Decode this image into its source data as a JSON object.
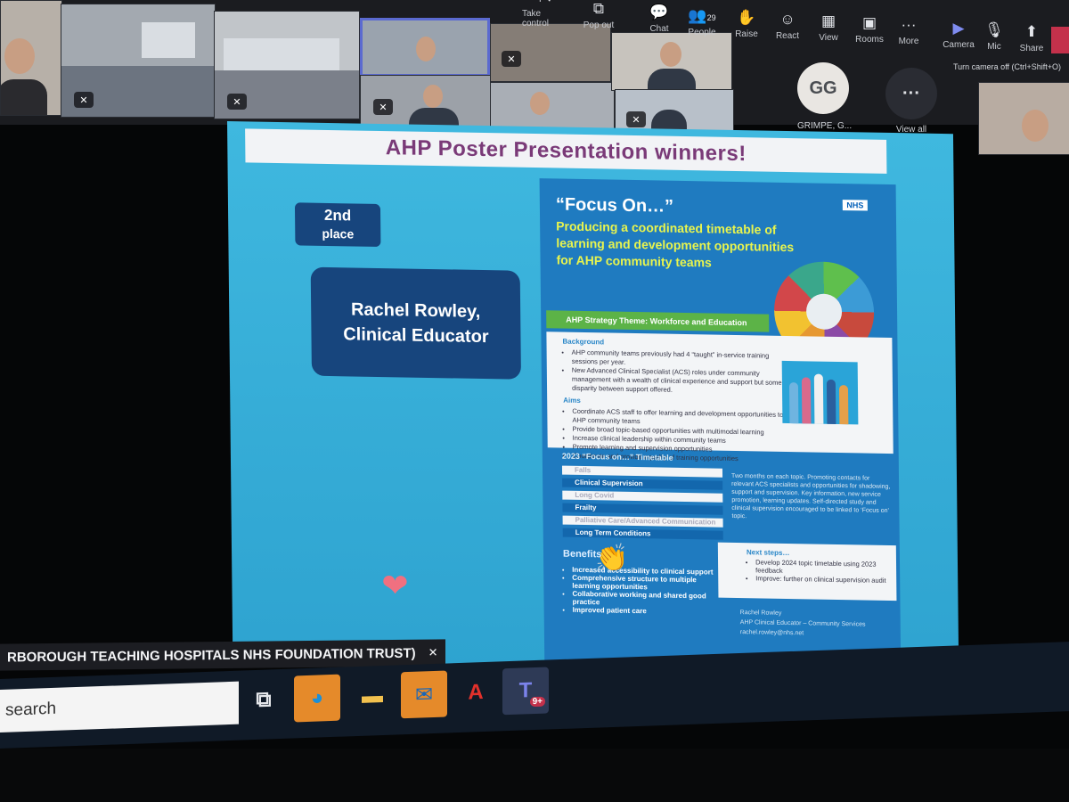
{
  "meeting": {
    "controls": [
      {
        "id": "take-control",
        "label": "Take control",
        "icon": "⇱"
      },
      {
        "id": "pop-out",
        "label": "Pop out",
        "icon": "⧉"
      },
      {
        "id": "chat",
        "label": "Chat",
        "icon": "💬"
      },
      {
        "id": "people",
        "label": "People",
        "icon": "👥",
        "count": "29"
      },
      {
        "id": "raise",
        "label": "Raise",
        "icon": "✋"
      },
      {
        "id": "react",
        "label": "React",
        "icon": "☺"
      },
      {
        "id": "view",
        "label": "View",
        "icon": "▦"
      },
      {
        "id": "rooms",
        "label": "Rooms",
        "icon": "▣"
      },
      {
        "id": "more",
        "label": "More",
        "icon": "···"
      },
      {
        "id": "camera",
        "label": "Camera",
        "icon": "▶"
      },
      {
        "id": "mic",
        "label": "Mic",
        "icon": "🎙"
      },
      {
        "id": "share",
        "label": "Share",
        "icon": "⬆"
      }
    ],
    "camera_tooltip": "Turn camera off (Ctrl+Shift+O)",
    "avatar": {
      "initials": "GG",
      "name": "GRIMPE, G..."
    },
    "view_all": {
      "icon": "···",
      "label": "View all"
    }
  },
  "slide": {
    "title": "AHP Poster Presentation winners!",
    "badge_line1": "2nd",
    "badge_line2": "place",
    "winner_name": "Rachel Rowley,",
    "winner_role": "Clinical Educator",
    "heart_icon": "❤",
    "poster": {
      "nhs": "NHS",
      "heading": "“Focus On…”",
      "subtitle": "Producing a coordinated timetable of learning and development opportunities for AHP community teams",
      "theme": "AHP Strategy Theme: Workforce and Education",
      "background_title": "Background",
      "background_items": [
        "AHP community teams previously had 4 “taught” in-service training sessions per year.",
        "New Advanced Clinical Specialist (ACS) roles under community management with a wealth of clinical experience and support but some disparity between support offered."
      ],
      "aims_title": "Aims",
      "aims_items": [
        "Coordinate ACS staff to offer learning and development opportunities to AHP community teams",
        "Provide broad topic-based opportunities with multimodal learning",
        "Increase clinical leadership within community teams",
        "Promote learning and supervision opportunities",
        "Coordinate and provide equality of training opportunities"
      ],
      "timetable_title": "2023 “Focus on…” Timetable",
      "timetable": [
        "Falls",
        "Clinical Supervision",
        "Long Covid",
        "Frailty",
        "Palliative Care/Advanced Communication",
        "Long Term Conditions"
      ],
      "timetable_text": "Two months on each topic. Promoting contacts for relevant ACS specialists and opportunities for shadowing, support and supervision. Key information, new service promotion, learning updates. Self-directed study and clinical supervision encouraged to be linked to ‘Focus on’ topic.",
      "benefits_title": "Benefits",
      "benefits": [
        "Increased accessibility to clinical support",
        "Comprehensive structure to multiple learning opportunities",
        "Collaborative working and shared good practice",
        "Improved patient care"
      ],
      "next_title": "Next steps…",
      "next_items": [
        "Develop 2024 topic timetable using 2023 feedback",
        "Improve: further on clinical supervision audit"
      ],
      "author_name": "Rachel Rowley",
      "author_role": "AHP Clinical Educator – Community Services",
      "author_email": "rachel.rowley@nhs.net"
    },
    "hand_icon": "👏"
  },
  "presenter_caption": "RBOROUGH TEACHING HOSPITALS NHS FOUNDATION TRUST)",
  "taskbar": {
    "search_placeholder": "search",
    "apps": [
      {
        "id": "task-view",
        "icon": "⧉",
        "color": "#101a27"
      },
      {
        "id": "edge",
        "icon": "◕",
        "color": "#e58a2a"
      },
      {
        "id": "file-explorer",
        "icon": "▬",
        "color": "#1f2b3b"
      },
      {
        "id": "outlook",
        "icon": "✉",
        "color": "#e58a2a"
      },
      {
        "id": "acrobat",
        "icon": "A",
        "color": "#1f2b3b"
      },
      {
        "id": "teams",
        "icon": "T",
        "color": "#2e3a56"
      }
    ],
    "teams_badge": "9+"
  }
}
